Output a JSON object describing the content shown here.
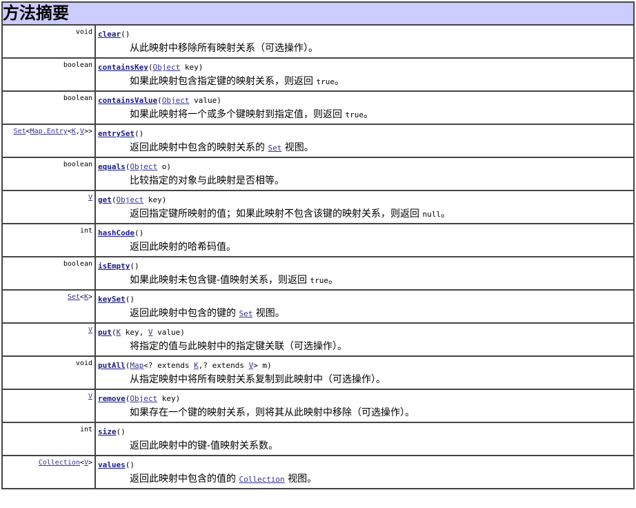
{
  "title": "方法摘要",
  "methods": [
    {
      "type": [
        {
          "t": "void"
        }
      ],
      "name": "clear",
      "sig": [
        {
          "t": "()"
        }
      ],
      "desc": [
        {
          "t": "从此映射中移除所有映射关系（可选操作）。"
        }
      ]
    },
    {
      "type": [
        {
          "t": "boolean"
        }
      ],
      "name": "containsKey",
      "sig": [
        {
          "t": "("
        },
        {
          "t": "Object",
          "link": true
        },
        {
          "t": "  key)"
        }
      ],
      "desc": [
        {
          "t": "如果此映射包含指定键的映射关系，则返回 "
        },
        {
          "t": "true",
          "mono": true
        },
        {
          "t": "。"
        }
      ]
    },
    {
      "type": [
        {
          "t": "boolean"
        }
      ],
      "name": "containsValue",
      "sig": [
        {
          "t": "("
        },
        {
          "t": "Object",
          "link": true
        },
        {
          "t": "  value)"
        }
      ],
      "desc": [
        {
          "t": "如果此映射将一个或多个键映射到指定值，则返回 "
        },
        {
          "t": "true",
          "mono": true
        },
        {
          "t": "。"
        }
      ]
    },
    {
      "type": [
        {
          "t": "Set",
          "link": true
        },
        {
          "t": "<"
        },
        {
          "t": "Map.Entry",
          "link": true
        },
        {
          "t": "<"
        },
        {
          "t": "K",
          "link": true
        },
        {
          "t": ","
        },
        {
          "t": "V",
          "link": true
        },
        {
          "t": ">>"
        }
      ],
      "name": "entrySet",
      "sig": [
        {
          "t": "()"
        }
      ],
      "desc": [
        {
          "t": "返回此映射中包含的映射关系的 "
        },
        {
          "t": "Set",
          "mono": true,
          "link": true
        },
        {
          "t": " 视图。"
        }
      ]
    },
    {
      "type": [
        {
          "t": "boolean"
        }
      ],
      "name": "equals",
      "sig": [
        {
          "t": "("
        },
        {
          "t": "Object",
          "link": true
        },
        {
          "t": "  o)"
        }
      ],
      "desc": [
        {
          "t": "比较指定的对象与此映射是否相等。"
        }
      ]
    },
    {
      "type": [
        {
          "t": "V",
          "link": true
        }
      ],
      "name": "get",
      "sig": [
        {
          "t": "("
        },
        {
          "t": "Object",
          "link": true
        },
        {
          "t": "  key)"
        }
      ],
      "desc": [
        {
          "t": "返回指定键所映射的值；如果此映射不包含该键的映射关系，则返回 "
        },
        {
          "t": "null",
          "mono": true
        },
        {
          "t": "。"
        }
      ]
    },
    {
      "type": [
        {
          "t": "int"
        }
      ],
      "name": "hashCode",
      "sig": [
        {
          "t": "()"
        }
      ],
      "desc": [
        {
          "t": "返回此映射的哈希码值。"
        }
      ]
    },
    {
      "type": [
        {
          "t": "boolean"
        }
      ],
      "name": "isEmpty",
      "sig": [
        {
          "t": "()"
        }
      ],
      "desc": [
        {
          "t": "如果此映射未包含键-值映射关系，则返回 "
        },
        {
          "t": "true",
          "mono": true
        },
        {
          "t": "。"
        }
      ]
    },
    {
      "type": [
        {
          "t": "Set",
          "link": true
        },
        {
          "t": "<"
        },
        {
          "t": "K",
          "link": true
        },
        {
          "t": ">"
        }
      ],
      "name": "keySet",
      "sig": [
        {
          "t": "()"
        }
      ],
      "desc": [
        {
          "t": "返回此映射中包含的键的 "
        },
        {
          "t": "Set",
          "mono": true,
          "link": true
        },
        {
          "t": " 视图。"
        }
      ]
    },
    {
      "type": [
        {
          "t": "V",
          "link": true
        }
      ],
      "name": "put",
      "sig": [
        {
          "t": "("
        },
        {
          "t": "K",
          "link": true
        },
        {
          "t": "  key, "
        },
        {
          "t": "V",
          "link": true
        },
        {
          "t": "  value)"
        }
      ],
      "desc": [
        {
          "t": "将指定的值与此映射中的指定键关联（可选操作）。"
        }
      ]
    },
    {
      "type": [
        {
          "t": "void"
        }
      ],
      "name": "putAll",
      "sig": [
        {
          "t": "("
        },
        {
          "t": "Map",
          "link": true
        },
        {
          "t": "<? extends "
        },
        {
          "t": "K",
          "link": true
        },
        {
          "t": ",? extends "
        },
        {
          "t": "V",
          "link": true
        },
        {
          "t": ">  m)"
        }
      ],
      "desc": [
        {
          "t": "从指定映射中将所有映射关系复制到此映射中（可选操作）。"
        }
      ]
    },
    {
      "type": [
        {
          "t": "V",
          "link": true
        }
      ],
      "name": "remove",
      "sig": [
        {
          "t": "("
        },
        {
          "t": "Object",
          "link": true
        },
        {
          "t": "  key)"
        }
      ],
      "desc": [
        {
          "t": "如果存在一个键的映射关系，则将其从此映射中移除（可选操作）。"
        }
      ]
    },
    {
      "type": [
        {
          "t": "int"
        }
      ],
      "name": "size",
      "sig": [
        {
          "t": "()"
        }
      ],
      "desc": [
        {
          "t": "返回此映射中的键-值映射关系数。"
        }
      ]
    },
    {
      "type": [
        {
          "t": "Collection",
          "link": true
        },
        {
          "t": "<"
        },
        {
          "t": "V",
          "link": true
        },
        {
          "t": ">"
        }
      ],
      "name": "values",
      "sig": [
        {
          "t": "()"
        }
      ],
      "desc": [
        {
          "t": "返回此映射中包含的值的 "
        },
        {
          "t": "Collection",
          "mono": true,
          "link": true
        },
        {
          "t": " 视图。"
        }
      ]
    }
  ]
}
